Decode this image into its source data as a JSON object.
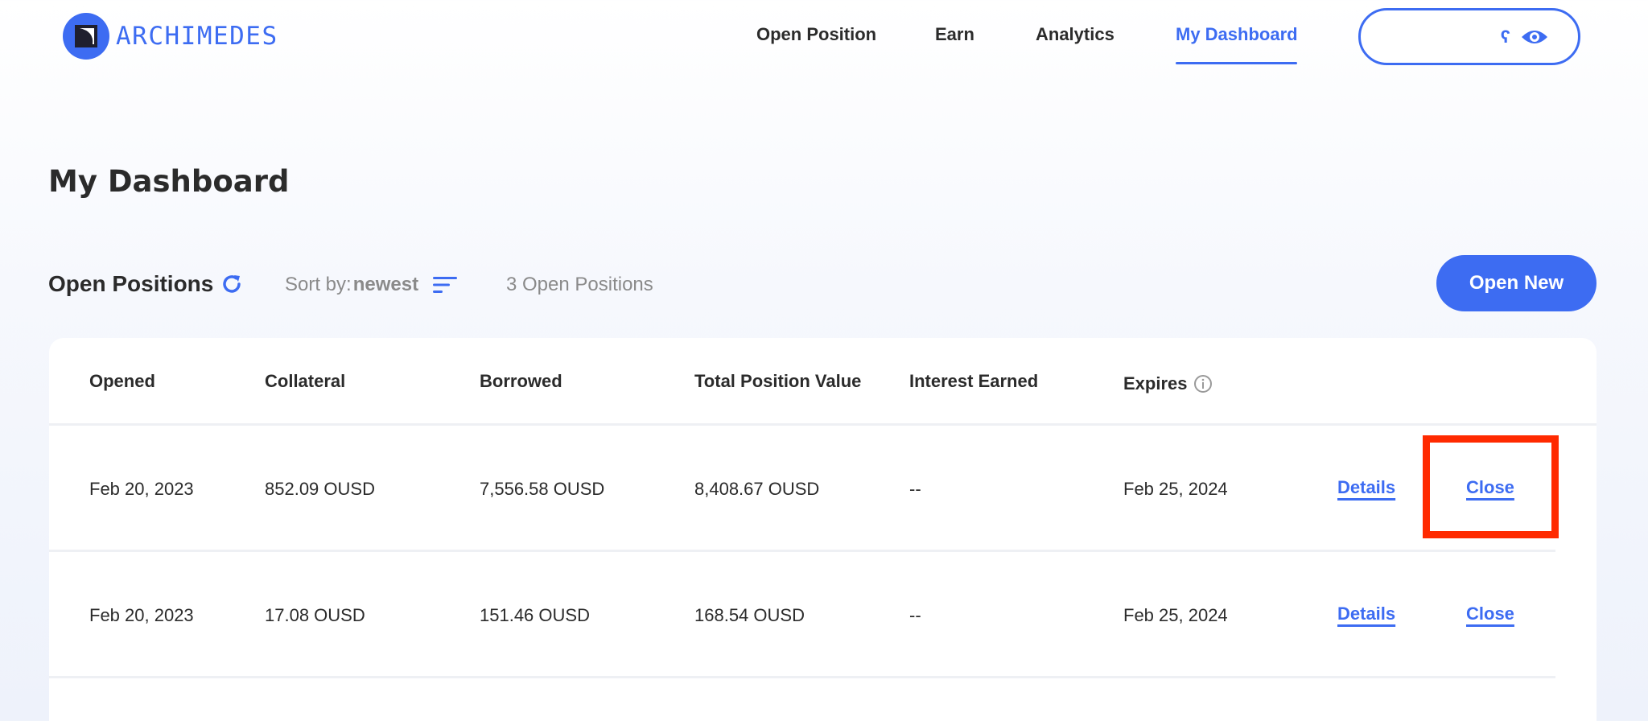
{
  "header": {
    "logo_text": "ARCHIMEDES",
    "nav": [
      {
        "label": "Open Position"
      },
      {
        "label": "Earn"
      },
      {
        "label": "Analytics"
      },
      {
        "label": "My Dashboard",
        "active": true
      }
    ],
    "wallet": {
      "text": "ʕ",
      "icon": "eye-icon"
    }
  },
  "page": {
    "title": "My Dashboard"
  },
  "toolbar": {
    "section_title": "Open Positions",
    "sort_label": "Sort by:",
    "sort_value": "newest",
    "count_text": "3 Open Positions",
    "open_new_label": "Open New"
  },
  "table": {
    "columns": [
      "Opened",
      "Collateral",
      "Borrowed",
      "Total Position Value",
      "Interest Earned",
      "Expires"
    ],
    "rows": [
      {
        "opened": "Feb 20, 2023",
        "collateral": "852.09 OUSD",
        "borrowed": "7,556.58 OUSD",
        "total": "8,408.67 OUSD",
        "interest": "--",
        "expires": "Feb 25, 2024",
        "details_label": "Details",
        "close_label": "Close"
      },
      {
        "opened": "Feb 20, 2023",
        "collateral": "17.08 OUSD",
        "borrowed": "151.46 OUSD",
        "total": "168.54 OUSD",
        "interest": "--",
        "expires": "Feb 25, 2024",
        "details_label": "Details",
        "close_label": "Close"
      }
    ]
  },
  "colors": {
    "accent": "#3d6cf2",
    "highlight": "#ff2a00",
    "text": "#2b2b2b",
    "muted": "#8a8a8a"
  }
}
